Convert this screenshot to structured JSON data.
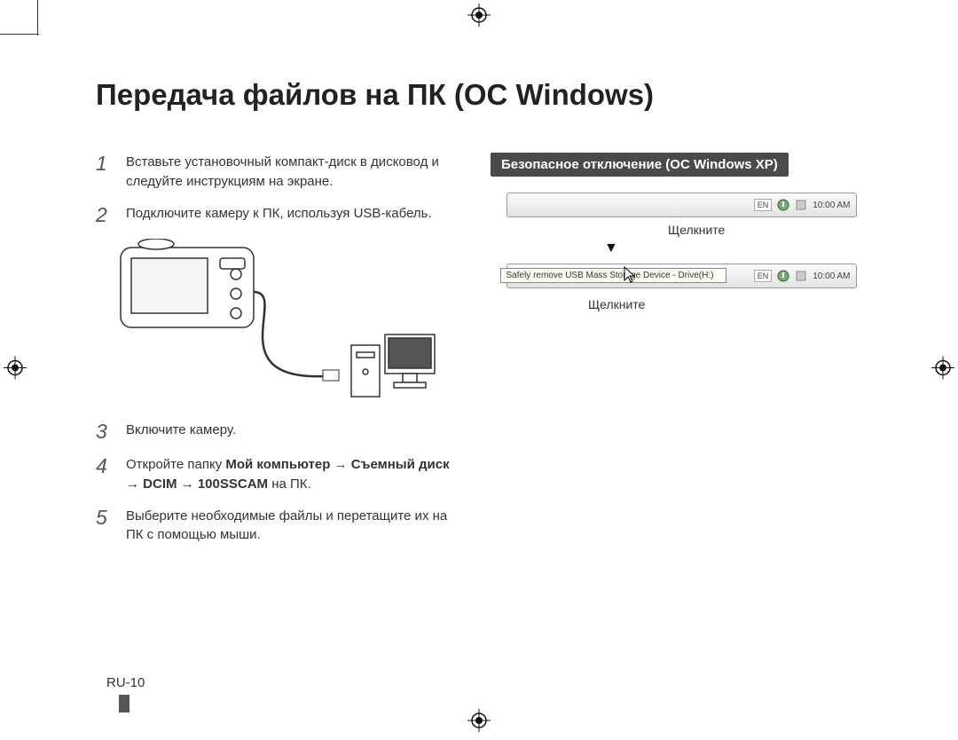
{
  "title": "Передача файлов на ПК (ОС Windows)",
  "steps": [
    {
      "num": "1",
      "text": "Вставьте установочный компакт-диск в дисковод и следуйте инструкциям на экране."
    },
    {
      "num": "2",
      "text": "Подключите камеру к ПК, используя USB-кабель."
    },
    {
      "num": "3",
      "text": "Включите камеру."
    },
    {
      "num": "4",
      "text_html": "Откройте папку <b>Мой компьютер</b> → <b>Съемный диск</b> → <b>DCIM</b> → <b>100SSCAM</b> на ПК."
    },
    {
      "num": "5",
      "text": "Выберите необходимые файлы и перетащите их на ПК с помощью мыши."
    }
  ],
  "callout": "Безопасное отключение (ОС Windows XP)",
  "taskbar": {
    "lang": "EN",
    "clock": "10:00 AM",
    "tooltip": "Safely remove USB Mass Storage Device - Drive(H:)"
  },
  "click_label": "Щелкните",
  "page_number": "RU-10"
}
